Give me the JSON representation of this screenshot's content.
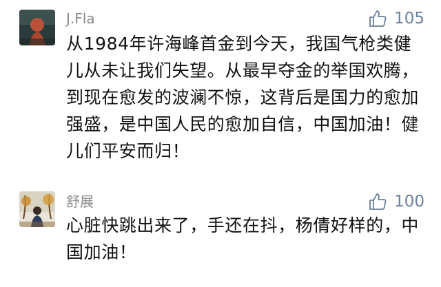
{
  "comments": [
    {
      "author": "J.Fla",
      "likes": "105",
      "text": "从1984年许海峰首金到今天，我国气枪类健儿从未让我们失望。从最早夺金的举国欢腾，到现在愈发的波澜不惊，这背后是国力的愈加强盛，是中国人民的愈加自信，中国加油！健儿们平安而归！",
      "avatar_icon": "person-avatar-icon",
      "like_icon": "thumbs-up-icon"
    },
    {
      "author": "舒展",
      "likes": "100",
      "text": "心脏快跳出来了，手还在抖，杨倩好样的，中国加油！",
      "avatar_icon": "person-avatar-icon",
      "like_icon": "thumbs-up-icon"
    }
  ],
  "colors": {
    "author": "#8a8a8a",
    "like": "#6a7f99",
    "text": "#111111",
    "background": "#ffffff"
  }
}
